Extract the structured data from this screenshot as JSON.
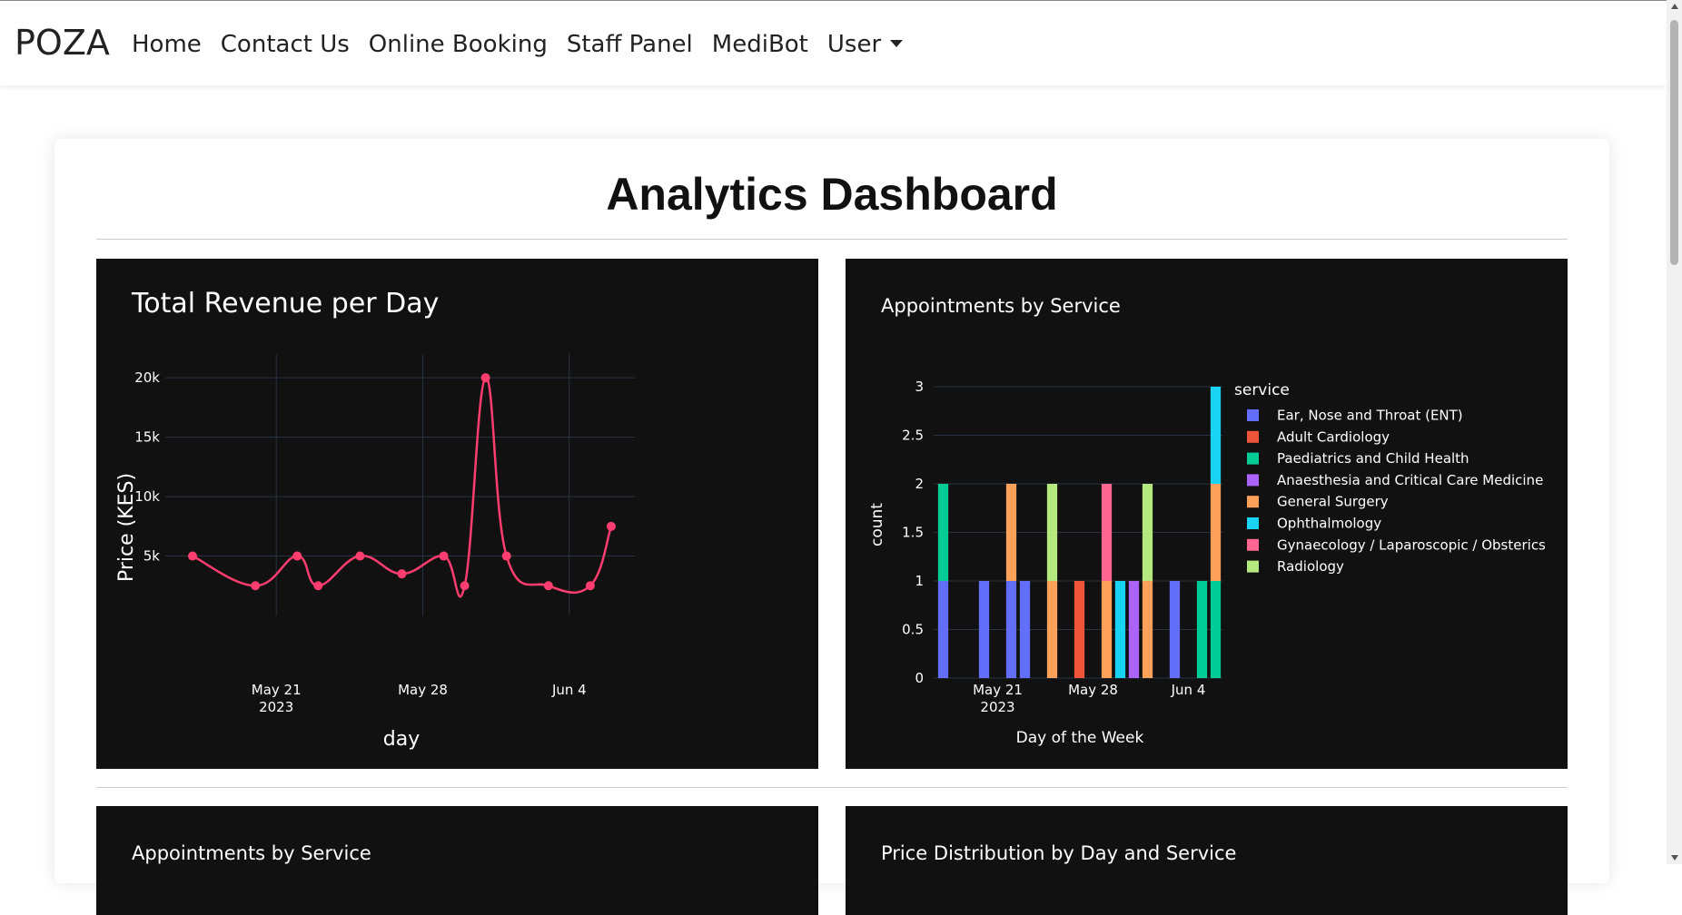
{
  "nav": {
    "brand": "POZA",
    "links": [
      {
        "label": "Home"
      },
      {
        "label": "Contact Us"
      },
      {
        "label": "Online Booking"
      },
      {
        "label": "Staff Panel"
      },
      {
        "label": "MediBot"
      }
    ],
    "user_label": "User"
  },
  "page": {
    "title": "Analytics Dashboard"
  },
  "panels": {
    "revenue": {
      "title": "Total Revenue per Day",
      "xlabel": "day",
      "ylabel": "Price (KES)"
    },
    "appointments": {
      "title": "Appointments by Service",
      "xlabel": "Day of the Week",
      "ylabel": "count",
      "legend_title": "service"
    },
    "appointments2": {
      "title": "Appointments by Service"
    },
    "price_dist": {
      "title": "Price Distribution by Day and Service"
    }
  },
  "colors": {
    "line": "#ff3d6e",
    "background": "#111111",
    "grid": "#283442"
  },
  "chart_data": [
    {
      "type": "line",
      "title": "Total Revenue per Day",
      "xlabel": "day",
      "ylabel": "Price (KES)",
      "x_ticks": [
        {
          "date": "2023-05-21",
          "label": "May 21",
          "sublabel": "2023"
        },
        {
          "date": "2023-05-28",
          "label": "May 28",
          "sublabel": ""
        },
        {
          "date": "2023-06-04",
          "label": "Jun 4",
          "sublabel": ""
        }
      ],
      "x_range": [
        "2023-05-17",
        "2023-06-07"
      ],
      "y_ticks": [
        {
          "v": 5000,
          "label": "5k"
        },
        {
          "v": 10000,
          "label": "10k"
        },
        {
          "v": 15000,
          "label": "15k"
        },
        {
          "v": 20000,
          "label": "20k"
        }
      ],
      "ylim": [
        0,
        22000
      ],
      "grid": true,
      "points": [
        {
          "x": "2023-05-17",
          "y": 5000
        },
        {
          "x": "2023-05-20",
          "y": 2500
        },
        {
          "x": "2023-05-22",
          "y": 5000
        },
        {
          "x": "2023-05-23",
          "y": 2500
        },
        {
          "x": "2023-05-25",
          "y": 5000
        },
        {
          "x": "2023-05-27",
          "y": 3500
        },
        {
          "x": "2023-05-29",
          "y": 5000
        },
        {
          "x": "2023-05-30",
          "y": 2500
        },
        {
          "x": "2023-05-31",
          "y": 20000
        },
        {
          "x": "2023-06-01",
          "y": 5000
        },
        {
          "x": "2023-06-03",
          "y": 2500
        },
        {
          "x": "2023-06-05",
          "y": 2500
        },
        {
          "x": "2023-06-06",
          "y": 7500
        }
      ]
    },
    {
      "type": "bar",
      "title": "Appointments by Service",
      "xlabel": "Day of the Week",
      "ylabel": "count",
      "legend_title": "service",
      "legend_position": "right",
      "x_ticks": [
        {
          "date": "2023-05-21",
          "label": "May 21",
          "sublabel": "2023"
        },
        {
          "date": "2023-05-28",
          "label": "May 28",
          "sublabel": ""
        },
        {
          "date": "2023-06-04",
          "label": "Jun 4",
          "sublabel": ""
        }
      ],
      "x_range": [
        "2023-05-17",
        "2023-06-06"
      ],
      "y_ticks": [
        {
          "v": 0,
          "label": "0"
        },
        {
          "v": 0.5,
          "label": "0.5"
        },
        {
          "v": 1,
          "label": "1"
        },
        {
          "v": 1.5,
          "label": "1.5"
        },
        {
          "v": 2,
          "label": "2"
        },
        {
          "v": 2.5,
          "label": "2.5"
        },
        {
          "v": 3,
          "label": "3"
        }
      ],
      "ylim": [
        0,
        3
      ],
      "grid": true,
      "series": [
        {
          "name": "Ear, Nose and Throat (ENT)",
          "color": "#636efa",
          "points": [
            {
              "x": "2023-05-17",
              "y": 1
            },
            {
              "x": "2023-05-20",
              "y": 1
            },
            {
              "x": "2023-05-22",
              "y": 1
            },
            {
              "x": "2023-05-23",
              "y": 1
            },
            {
              "x": "2023-06-03",
              "y": 1
            }
          ]
        },
        {
          "name": "Adult Cardiology",
          "color": "#ef553b",
          "points": [
            {
              "x": "2023-05-27",
              "y": 1
            }
          ]
        },
        {
          "name": "Paediatrics and Child Health",
          "color": "#00cc96",
          "points": [
            {
              "x": "2023-05-17",
              "y": 1
            },
            {
              "x": "2023-06-05",
              "y": 1
            },
            {
              "x": "2023-06-06",
              "y": 1
            }
          ]
        },
        {
          "name": "Anaesthesia and Critical Care Medicine",
          "color": "#ab63fa",
          "points": [
            {
              "x": "2023-05-31",
              "y": 1
            }
          ]
        },
        {
          "name": "General Surgery",
          "color": "#ffa15a",
          "points": [
            {
              "x": "2023-05-22",
              "y": 1
            },
            {
              "x": "2023-05-25",
              "y": 1
            },
            {
              "x": "2023-05-29",
              "y": 1
            },
            {
              "x": "2023-06-01",
              "y": 1
            },
            {
              "x": "2023-06-06",
              "y": 1
            }
          ]
        },
        {
          "name": "Ophthalmology",
          "color": "#19d3f3",
          "points": [
            {
              "x": "2023-05-30",
              "y": 1
            },
            {
              "x": "2023-06-06",
              "y": 1
            }
          ]
        },
        {
          "name": "Gynaecology / Laparoscopic / Obsterics",
          "color": "#ff6692",
          "points": [
            {
              "x": "2023-05-29",
              "y": 1
            }
          ]
        },
        {
          "name": "Radiology",
          "color": "#b6e880",
          "points": [
            {
              "x": "2023-05-25",
              "y": 1
            },
            {
              "x": "2023-06-01",
              "y": 1
            }
          ]
        }
      ]
    }
  ]
}
